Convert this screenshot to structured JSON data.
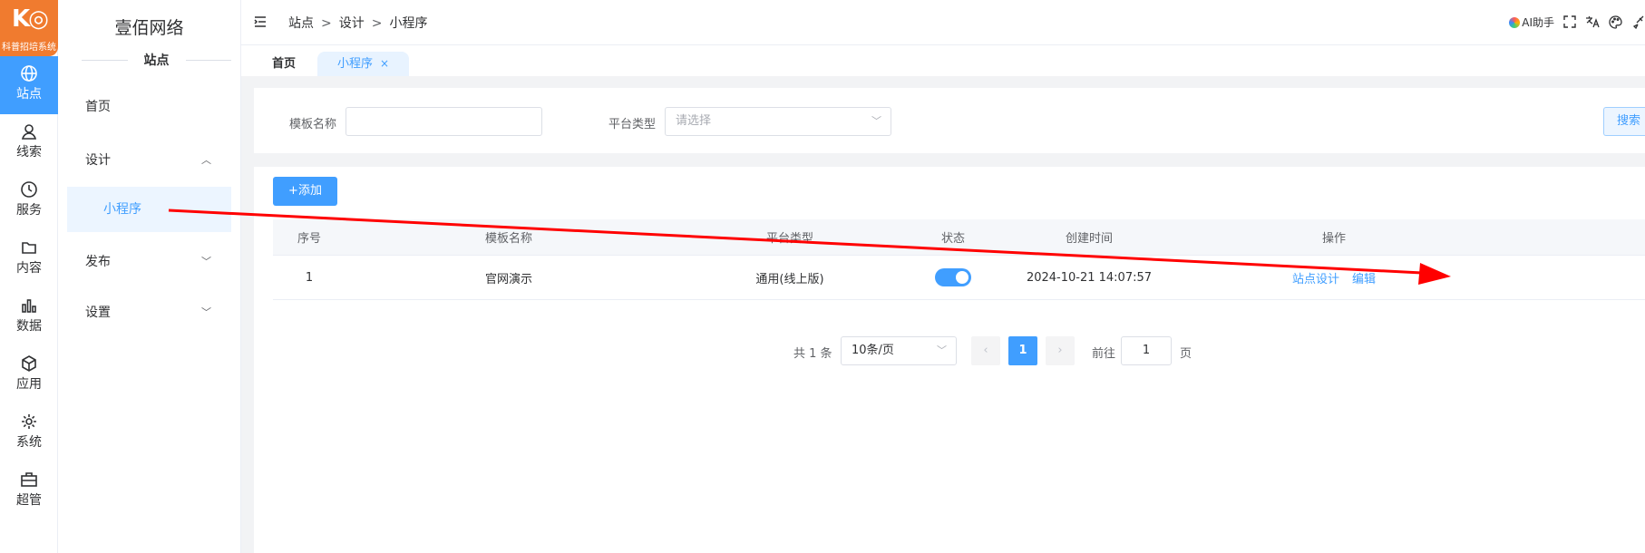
{
  "logo": {
    "caption": "科普招培系统"
  },
  "rail": [
    {
      "label": "站点",
      "icon": "globe-icon",
      "active": true
    },
    {
      "label": "线索",
      "icon": "user-icon"
    },
    {
      "label": "服务",
      "icon": "clock-icon"
    },
    {
      "label": "内容",
      "icon": "folder-icon"
    },
    {
      "label": "数据",
      "icon": "bar-chart-icon"
    },
    {
      "label": "应用",
      "icon": "cube-icon"
    },
    {
      "label": "系统",
      "icon": "gear-icon"
    },
    {
      "label": "超管",
      "icon": "briefcase-icon"
    }
  ],
  "submenu": {
    "brand": "壹佰网络",
    "section": "站点",
    "items": {
      "home": "首页",
      "design": "设计",
      "miniapp": "小程序",
      "publish": "发布",
      "settings": "设置"
    }
  },
  "header": {
    "breadcrumb": [
      "站点",
      "设计",
      "小程序"
    ],
    "separator": ">",
    "ai_label": "AI助手"
  },
  "tabs": {
    "home": "首页",
    "active": "小程序",
    "close": "×"
  },
  "search": {
    "template_label": "模板名称",
    "template_value": "",
    "platform_label": "平台类型",
    "platform_placeholder": "请选择",
    "search_button": "搜索"
  },
  "toolbar": {
    "add_label": "+添加"
  },
  "table": {
    "columns": [
      "序号",
      "模板名称",
      "平台类型",
      "状态",
      "创建时间",
      "操作"
    ],
    "rows": [
      {
        "index": "1",
        "name": "官网演示",
        "platform": "通用(线上版)",
        "enabled": true,
        "created": "2024-10-21 14:07:57",
        "actions": [
          "站点设计",
          "编辑"
        ]
      }
    ]
  },
  "pagination": {
    "total_text": "共 1 条",
    "page_size": "10条/页",
    "current_page": "1",
    "goto_label": "前往",
    "goto_value": "1",
    "page_unit": "页"
  },
  "colors": {
    "primary": "#409eff",
    "annotation_arrow": "#ff0000",
    "logo": "#f07b2f"
  }
}
